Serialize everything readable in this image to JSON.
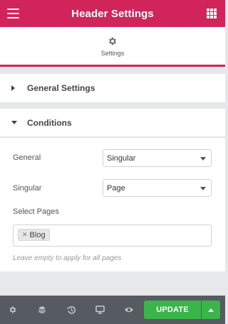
{
  "header": {
    "title": "Header Settings",
    "menu_icon": "hamburger-icon",
    "apps_icon": "grid-icon",
    "accent_color": "#d0245a"
  },
  "tabs": [
    {
      "label": "Settings",
      "icon": "gear-icon",
      "active": true
    }
  ],
  "sections": {
    "general_settings": {
      "label": "General Settings",
      "expanded": false
    },
    "conditions": {
      "label": "Conditions",
      "expanded": true
    }
  },
  "conditions": {
    "general_label": "General",
    "general_value": "Singular",
    "singular_label": "Singular",
    "singular_value": "Page",
    "select_pages_label": "Select Pages",
    "selected_pages": [
      "Blog"
    ],
    "hint": "Leave empty to apply for all pages"
  },
  "footer": {
    "icons": [
      "gear-icon",
      "layers-icon",
      "history-icon",
      "responsive-icon",
      "eye-icon"
    ],
    "update_label": "UPDATE",
    "update_color": "#39b54a"
  }
}
